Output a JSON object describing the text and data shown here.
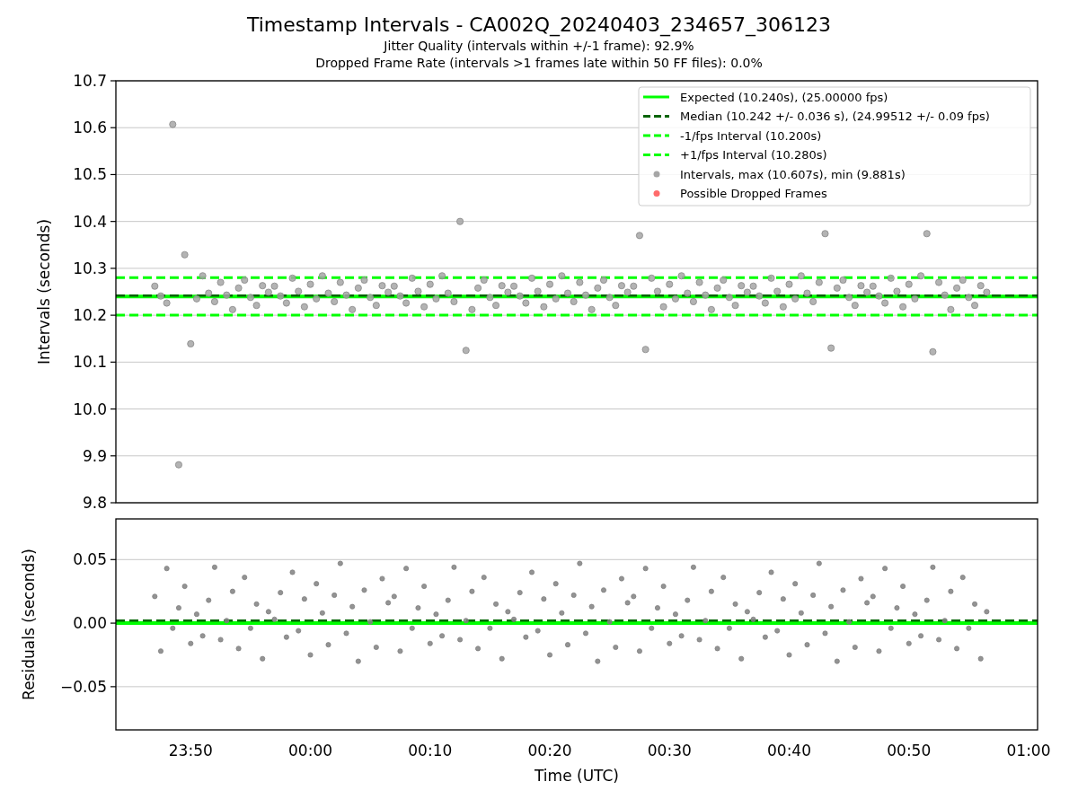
{
  "figure": {
    "title": "Timestamp Intervals - CA002Q_20240403_234657_306123",
    "subtitles": [
      "Jitter Quality (intervals within +/-1 frame): 92.9%",
      "Dropped Frame Rate (intervals >1 frames late within 50 FF files): 0.0%"
    ]
  },
  "panels": [
    {
      "chart_data": {
        "type": "scatter",
        "ylabel": "Intervals (seconds)",
        "ylim": [
          9.8,
          10.7
        ],
        "grid": true,
        "legend": true,
        "categories": [
          null,
          null,
          null,
          null,
          null,
          null,
          null,
          null,
          null,
          null,
          null,
          null,
          null,
          null,
          null,
          null,
          null,
          null,
          null,
          null,
          null,
          null,
          null,
          null,
          null,
          null,
          null,
          null,
          null,
          null,
          null,
          null,
          null,
          null,
          null,
          null,
          null,
          null,
          null,
          null,
          null,
          null,
          null,
          null,
          null,
          null,
          null,
          null,
          null,
          null,
          null,
          null,
          null,
          null,
          null,
          null,
          null,
          null,
          null,
          null,
          null,
          null,
          null,
          null,
          null,
          null,
          null,
          null,
          null,
          null,
          null,
          null,
          null,
          null,
          null,
          null,
          null,
          null,
          null,
          null,
          null,
          null,
          null,
          null,
          null,
          null,
          null,
          null,
          null,
          null,
          null,
          null,
          null,
          null,
          null,
          null,
          null,
          null,
          null,
          null,
          null,
          null,
          null,
          null,
          null,
          null,
          null,
          null,
          null,
          null,
          null,
          null,
          null,
          null,
          null,
          null,
          null,
          null,
          null,
          null,
          null,
          null,
          null,
          null,
          null,
          null,
          null,
          null,
          null,
          null,
          null,
          null,
          null,
          null,
          null,
          null,
          null,
          null,
          null,
          null,
          null,
          null,
          null,
          null,
          null,
          null,
          null,
          null,
          null,
          null,
          null,
          null,
          null,
          null
        ],
        "yticks": [
          {
            "value": 9.8,
            "label": "9.8"
          },
          {
            "value": 9.9,
            "label": "9.9"
          },
          {
            "value": 10.0,
            "label": "10.0"
          },
          {
            "value": 10.1,
            "label": "10.1"
          },
          {
            "value": 10.2,
            "label": "10.2"
          },
          {
            "value": 10.3,
            "label": "10.3"
          },
          {
            "value": 10.4,
            "label": "10.4"
          },
          {
            "value": 10.5,
            "label": "10.5"
          },
          {
            "value": 10.6,
            "label": "10.6"
          },
          {
            "value": 10.7,
            "label": "10.7"
          }
        ],
        "ref_lines": [
          {
            "axis": "y",
            "value": 10.24,
            "label": "Expected (10.240s), (25.00000 fps)"
          },
          {
            "axis": "y",
            "value": 10.242,
            "label": "Median (10.242 +/- 0.036 s), (24.99512 +/- 0.09 fps)"
          },
          {
            "axis": "y",
            "value": 10.2,
            "label": "-1/fps Interval (10.200s)"
          },
          {
            "axis": "y",
            "value": 10.28,
            "label": "+1/fps Interval (10.280s)"
          }
        ],
        "series": [
          {
            "name": "Intervals, max (10.607s), min (9.881s)",
            "color": "#a6a6a6",
            "values": [
              null,
              null,
              null,
              null,
              null,
              null,
              10.262,
              10.241,
              10.226,
              10.607,
              9.881,
              10.329,
              10.139,
              10.235,
              10.284,
              10.247,
              10.229,
              10.27,
              10.243,
              10.212,
              10.258,
              10.275,
              10.238,
              10.221,
              10.263,
              10.249,
              10.262,
              10.241,
              10.226,
              10.279,
              10.251,
              10.218,
              10.266,
              10.235,
              10.284,
              10.247,
              10.229,
              10.27,
              10.243,
              10.212,
              10.258,
              10.275,
              10.238,
              10.221,
              10.263,
              10.249,
              10.262,
              10.241,
              10.226,
              10.279,
              10.251,
              10.218,
              10.266,
              10.235,
              10.284,
              10.247,
              10.229,
              10.4,
              10.125,
              10.212,
              10.258,
              10.275,
              10.238,
              10.221,
              10.263,
              10.249,
              10.262,
              10.241,
              10.226,
              10.279,
              10.251,
              10.218,
              10.266,
              10.235,
              10.284,
              10.247,
              10.229,
              10.27,
              10.243,
              10.212,
              10.258,
              10.275,
              10.238,
              10.221,
              10.263,
              10.249,
              10.262,
              10.37,
              10.127,
              10.279,
              10.251,
              10.218,
              10.266,
              10.235,
              10.284,
              10.247,
              10.229,
              10.27,
              10.243,
              10.212,
              10.258,
              10.275,
              10.238,
              10.221,
              10.263,
              10.249,
              10.262,
              10.241,
              10.226,
              10.279,
              10.251,
              10.218,
              10.266,
              10.235,
              10.284,
              10.247,
              10.229,
              10.27,
              10.374,
              10.13,
              10.258,
              10.275,
              10.238,
              10.221,
              10.263,
              10.249,
              10.262,
              10.241,
              10.226,
              10.279,
              10.251,
              10.218,
              10.266,
              10.235,
              10.284,
              10.374,
              10.122,
              10.27,
              10.243,
              10.212,
              10.258,
              10.275,
              10.238,
              10.221,
              10.263,
              10.249,
              null,
              null,
              null,
              null,
              null,
              null,
              null,
              null
            ]
          }
        ]
      },
      "legend_extra": {
        "label": "Possible Dropped Frames",
        "color": "#ff6b6b"
      }
    },
    {
      "chart_data": {
        "type": "scatter",
        "xlabel": "Time (UTC)",
        "ylabel": "Residuals (seconds)",
        "ylim": [
          -0.084,
          0.082
        ],
        "grid": true,
        "categories": [
          null,
          null,
          null,
          null,
          null,
          null,
          null,
          null,
          null,
          null,
          null,
          null,
          "23:50",
          null,
          null,
          null,
          null,
          null,
          null,
          null,
          null,
          null,
          null,
          null,
          null,
          null,
          null,
          null,
          null,
          null,
          null,
          null,
          "00:00",
          null,
          null,
          null,
          null,
          null,
          null,
          null,
          null,
          null,
          null,
          null,
          null,
          null,
          null,
          null,
          null,
          null,
          null,
          null,
          "00:10",
          null,
          null,
          null,
          null,
          null,
          null,
          null,
          null,
          null,
          null,
          null,
          null,
          null,
          null,
          null,
          null,
          null,
          null,
          null,
          "00:20",
          null,
          null,
          null,
          null,
          null,
          null,
          null,
          null,
          null,
          null,
          null,
          null,
          null,
          null,
          null,
          null,
          null,
          null,
          null,
          "00:30",
          null,
          null,
          null,
          null,
          null,
          null,
          null,
          null,
          null,
          null,
          null,
          null,
          null,
          null,
          null,
          null,
          null,
          null,
          null,
          "00:40",
          null,
          null,
          null,
          null,
          null,
          null,
          null,
          null,
          null,
          null,
          null,
          null,
          null,
          null,
          null,
          null,
          null,
          null,
          null,
          "00:50",
          null,
          null,
          null,
          null,
          null,
          null,
          null,
          null,
          null,
          null,
          null,
          null,
          null,
          null,
          null,
          null,
          null,
          null,
          null,
          "01:00",
          null
        ],
        "yticks": [
          {
            "value": -0.05,
            "label": "−0.05"
          },
          {
            "value": 0,
            "label": "0.00"
          },
          {
            "value": 0.05,
            "label": "0.05"
          }
        ],
        "ref_lines": [
          {
            "axis": "y",
            "value": 0
          },
          {
            "axis": "y",
            "value": 0.002
          }
        ],
        "series": [
          {
            "color": "#808080",
            "values": [
              null,
              null,
              null,
              null,
              null,
              null,
              0.021,
              -0.022,
              0.043,
              -0.004,
              0.012,
              0.029,
              -0.016,
              0.007,
              -0.01,
              0.018,
              0.044,
              -0.013,
              0.002,
              0.025,
              -0.02,
              0.036,
              -0.004,
              0.015,
              -0.028,
              0.009,
              0.003,
              0.024,
              -0.011,
              0.04,
              -0.006,
              0.019,
              -0.025,
              0.031,
              0.008,
              -0.017,
              0.022,
              0.047,
              -0.008,
              0.013,
              -0.03,
              0.026,
              0.001,
              -0.019,
              0.035,
              0.016,
              0.021,
              -0.022,
              0.043,
              -0.004,
              0.012,
              0.029,
              -0.016,
              0.007,
              -0.01,
              0.018,
              0.044,
              -0.013,
              0.002,
              0.025,
              -0.02,
              0.036,
              -0.004,
              0.015,
              -0.028,
              0.009,
              0.003,
              0.024,
              -0.011,
              0.04,
              -0.006,
              0.019,
              -0.025,
              0.031,
              0.008,
              -0.017,
              0.022,
              0.047,
              -0.008,
              0.013,
              -0.03,
              0.026,
              0.001,
              -0.019,
              0.035,
              0.016,
              0.021,
              -0.022,
              0.043,
              -0.004,
              0.012,
              0.029,
              -0.016,
              0.007,
              -0.01,
              0.018,
              0.044,
              -0.013,
              0.002,
              0.025,
              -0.02,
              0.036,
              -0.004,
              0.015,
              -0.028,
              0.009,
              0.003,
              0.024,
              -0.011,
              0.04,
              -0.006,
              0.019,
              -0.025,
              0.031,
              0.008,
              -0.017,
              0.022,
              0.047,
              -0.008,
              0.013,
              -0.03,
              0.026,
              0.001,
              -0.019,
              0.035,
              0.016,
              0.021,
              -0.022,
              0.043,
              -0.004,
              0.012,
              0.029,
              -0.016,
              0.007,
              -0.01,
              0.018,
              0.044,
              -0.013,
              0.002,
              0.025,
              -0.02,
              0.036,
              -0.004,
              0.015,
              -0.028,
              0.009,
              null,
              null,
              null,
              null,
              null,
              null,
              null,
              null
            ]
          }
        ]
      }
    }
  ]
}
